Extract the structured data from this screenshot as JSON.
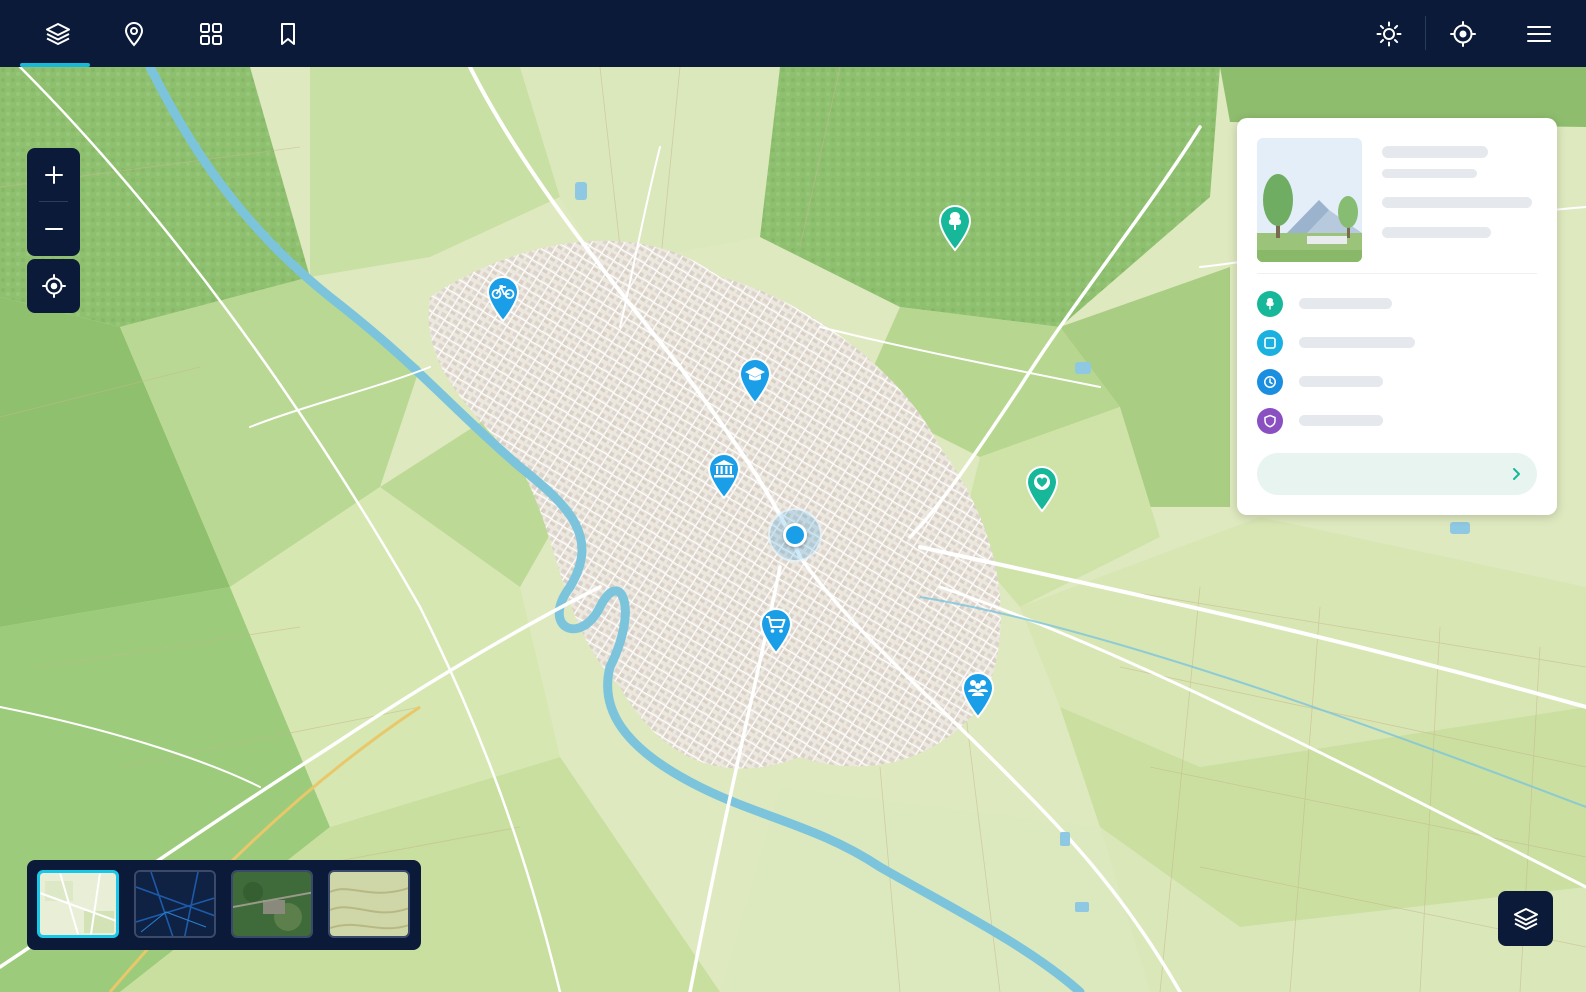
{
  "toolbar": {
    "left_icons": [
      "layers-icon",
      "map-pin-icon",
      "grid-icon",
      "bookmark-icon"
    ],
    "right_icons": [
      "brightness-icon",
      "locate-icon",
      "menu-icon"
    ],
    "active_tab": "layers-icon"
  },
  "map_controls": {
    "icons": [
      "plus-icon",
      "minus-icon",
      "crosshair-icon"
    ]
  },
  "markers": [
    {
      "type": "bicycle",
      "icon": "bicycle-icon",
      "color": "#1a9ee8"
    },
    {
      "type": "school",
      "icon": "graduation-cap-icon",
      "color": "#1a9ee8"
    },
    {
      "type": "museum",
      "icon": "institution-icon",
      "color": "#1a9ee8"
    },
    {
      "type": "shopping",
      "icon": "shopping-cart-icon",
      "color": "#1a9ee8"
    },
    {
      "type": "community",
      "icon": "people-icon",
      "color": "#1a9ee8"
    },
    {
      "type": "park",
      "icon": "tree-icon",
      "color": "#17b89a"
    },
    {
      "type": "health",
      "icon": "heart-icon",
      "color": "#17b89a"
    }
  ],
  "info_panel": {
    "row_icons": [
      {
        "icon": "tree-icon",
        "color": "#17b89a"
      },
      {
        "icon": "square-icon",
        "color": "#1ab0e0"
      },
      {
        "icon": "clock-icon",
        "color": "#1a8ee0"
      },
      {
        "icon": "shield-icon",
        "color": "#8a4fc0"
      }
    ],
    "action_icon": "chevron-right-icon"
  },
  "basemaps": [
    {
      "style": "light",
      "active": true
    },
    {
      "style": "dark",
      "active": false
    },
    {
      "style": "satellite",
      "active": false
    },
    {
      "style": "terrain",
      "active": false
    }
  ],
  "colors": {
    "chrome": "#0b1a38",
    "accent": "#19b8d8",
    "marker_blue": "#1a9ee8",
    "marker_green": "#17b89a",
    "river": "#7cc4dc"
  }
}
